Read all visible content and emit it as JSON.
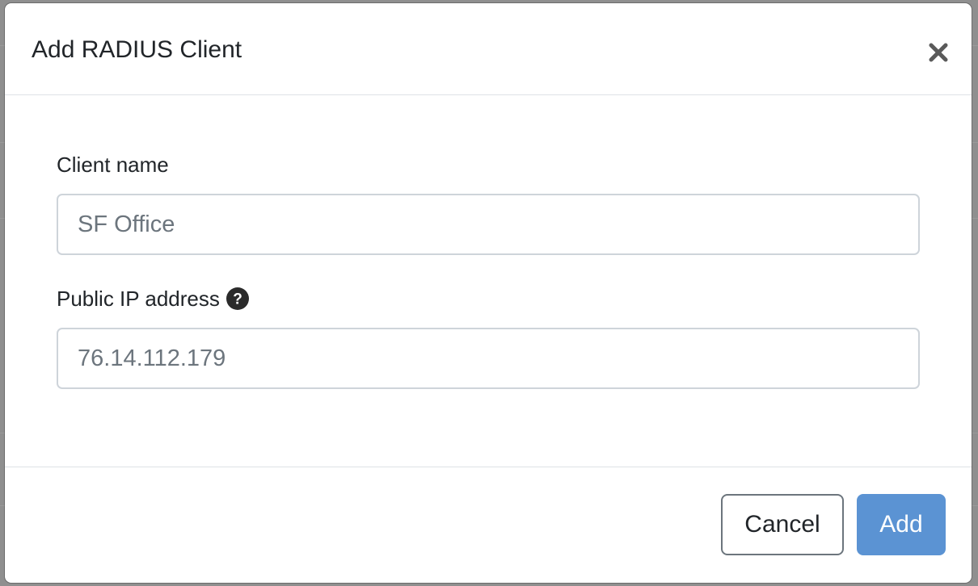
{
  "modal": {
    "title": "Add RADIUS Client",
    "close_icon": "close-icon"
  },
  "form": {
    "client_name": {
      "label": "Client name",
      "placeholder": "SF Office",
      "value": ""
    },
    "public_ip": {
      "label": "Public IP address",
      "help_icon": "question-circle-icon",
      "placeholder": "76.14.112.179",
      "value": ""
    }
  },
  "footer": {
    "cancel_label": "Cancel",
    "add_label": "Add"
  },
  "colors": {
    "primary": "#5b93d3",
    "backdrop": "#8f8f8f",
    "input_border": "#ced4da"
  }
}
